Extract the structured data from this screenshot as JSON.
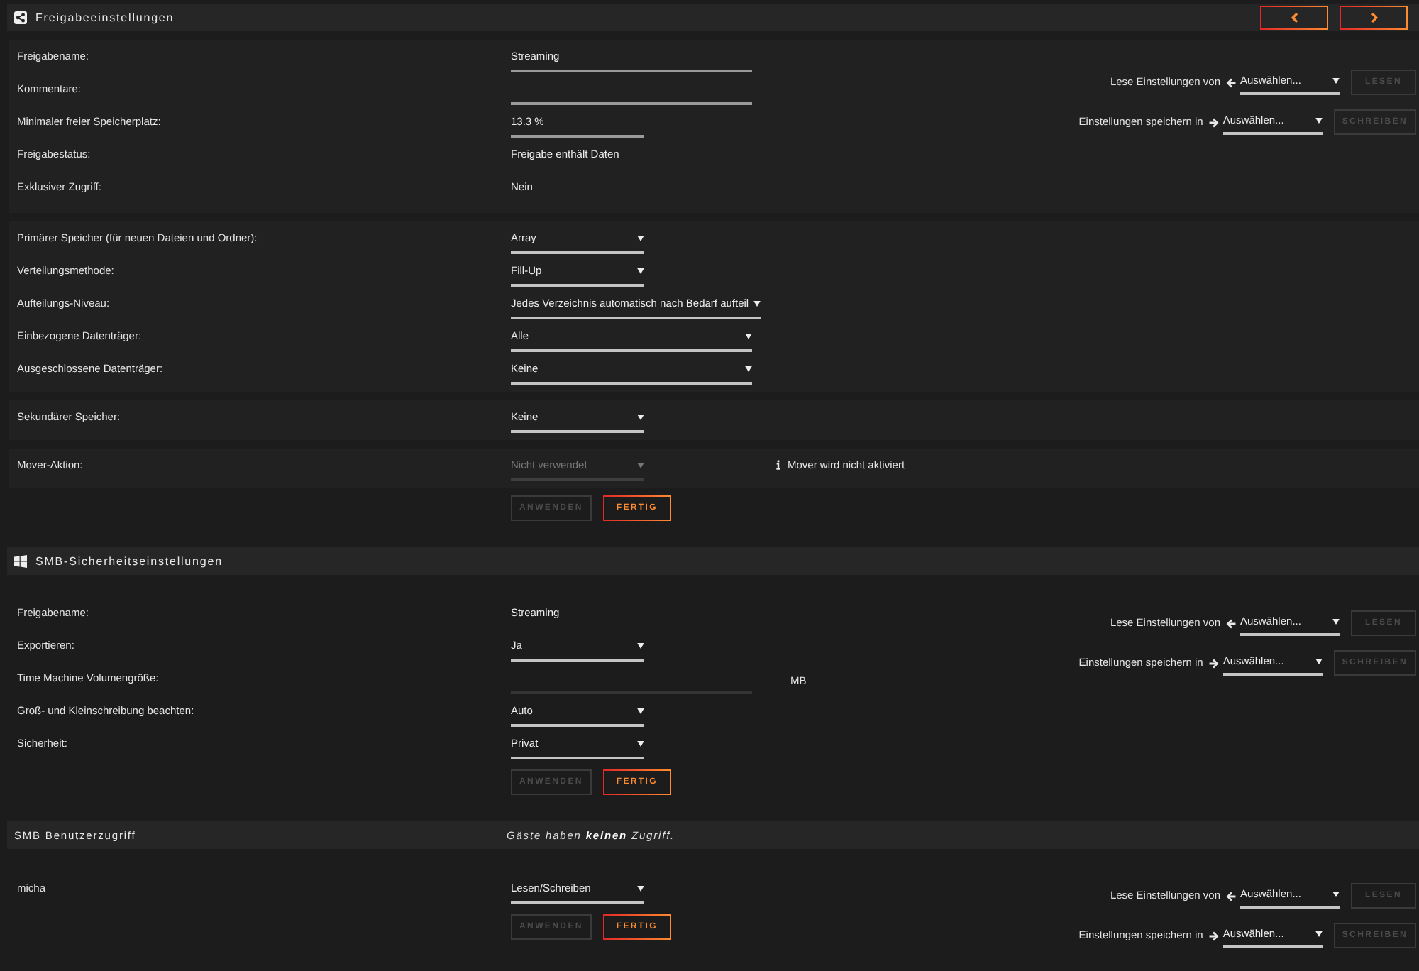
{
  "share_settings": {
    "title": "Freigabeeinstellungen",
    "general": [
      {
        "label": "Freigabename:",
        "kind": "text",
        "value": "Streaming",
        "disabled": false
      },
      {
        "label": "Kommentare:",
        "kind": "text",
        "disabled": false
      },
      {
        "label": "Minimaler freier Speicherplatz:",
        "kind": "number",
        "value": "13.3 %",
        "disabled": false
      },
      {
        "label": "Freigabestatus:",
        "kind": "static",
        "value": "Freigabe enthält Daten",
        "disabled": false
      },
      {
        "label": "Exklusiver Zugriff:",
        "kind": "static",
        "value": "Nein",
        "disabled": false
      }
    ],
    "copy": {
      "read_label": "Lese Einstellungen von",
      "read_select": "Auswählen...",
      "read_button": {
        "label": "LESEN",
        "disabled": true
      },
      "write_label": "Einstellungen speichern in",
      "write_select": "Auswählen...",
      "write_button": {
        "label": "SCHREIBEN",
        "disabled": true
      }
    },
    "storage": [
      {
        "label": "Primärer Speicher (für neuen Dateien und Ordner):",
        "kind": "select",
        "value": "Array",
        "disabled": false
      },
      {
        "label": "Verteilungsmethode:",
        "kind": "select",
        "value": "Fill-Up",
        "disabled": false
      },
      {
        "label": "Aufteilungs-Niveau:",
        "kind": "select",
        "value": "Jedes Verzeichnis automatisch nach Bedarf aufteil",
        "disabled": false
      },
      {
        "label": "Einbezogene Datenträger:",
        "kind": "multiselect",
        "value": "Alle",
        "disabled": false
      },
      {
        "label": "Ausgeschlossene Datenträger:",
        "kind": "multiselect",
        "value": "Keine",
        "disabled": false
      }
    ],
    "secondary": [
      {
        "label": "Sekundärer Speicher:",
        "kind": "select",
        "value": "Keine",
        "disabled": false
      }
    ],
    "mover": [
      {
        "label": "Mover-Aktion:",
        "kind": "select",
        "value": "Nicht verwendet",
        "disabled": true,
        "note": "Mover wird nicht aktiviert"
      }
    ],
    "buttons": [
      {
        "label": "ANWENDEN",
        "disabled": true
      },
      {
        "label": "FERTIG",
        "disabled": false
      }
    ]
  },
  "smb_security": {
    "title": "SMB-Sicherheitseinstellungen",
    "rows": [
      {
        "label": "Freigabename:",
        "kind": "static",
        "value": "Streaming",
        "disabled": false
      },
      {
        "label": "Exportieren:",
        "kind": "select",
        "value": "Ja",
        "disabled": false
      },
      {
        "label": "Time Machine Volumengröße:",
        "kind": "text",
        "unit": "MB",
        "disabled": true
      },
      {
        "label": "Groß- und Kleinschreibung beachten:",
        "kind": "select",
        "value": "Auto",
        "disabled": false
      },
      {
        "label": "Sicherheit:",
        "kind": "select",
        "value": "Privat",
        "disabled": false
      }
    ],
    "copy": {
      "read_label": "Lese Einstellungen von",
      "read_select": "Auswählen...",
      "read_button": {
        "label": "LESEN",
        "disabled": true
      },
      "write_label": "Einstellungen speichern in",
      "write_select": "Auswählen...",
      "write_button": {
        "label": "SCHREIBEN",
        "disabled": true
      }
    },
    "buttons": [
      {
        "label": "ANWENDEN",
        "disabled": true
      },
      {
        "label": "FERTIG",
        "disabled": false
      }
    ]
  },
  "smb_user_access": {
    "title": "SMB Benutzerzugriff",
    "note": "Gäste haben **keinen** Zugriff.",
    "users": [
      {
        "label": "micha",
        "kind": "select",
        "value": "Lesen/Schreiben",
        "disabled": false
      }
    ],
    "copy": {
      "read_label": "Lese Einstellungen von",
      "read_select": "Auswählen...",
      "read_button": {
        "label": "LESEN",
        "disabled": true
      },
      "write_label": "Einstellungen speichern in",
      "write_select": "Auswählen...",
      "write_button": {
        "label": "SCHREIBEN",
        "disabled": true
      }
    },
    "buttons": [
      {
        "label": "ANWENDEN",
        "disabled": true
      },
      {
        "label": "FERTIG",
        "disabled": false
      }
    ]
  }
}
